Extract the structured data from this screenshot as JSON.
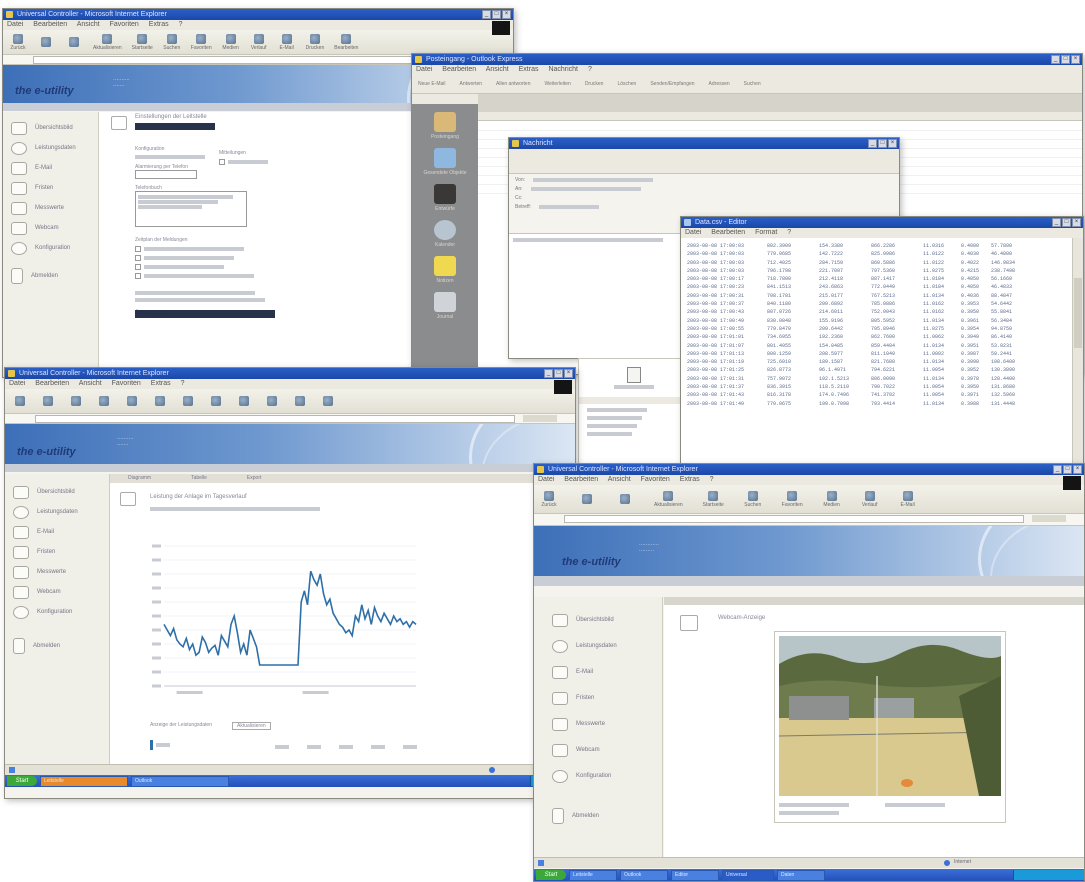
{
  "windows": {
    "topleft": {
      "title": "Universal Controller - Microsoft Internet Explorer",
      "menu": [
        "Datei",
        "Bearbeiten",
        "Ansicht",
        "Favoriten",
        "Extras",
        "?"
      ],
      "toolbar": [
        "Zurück",
        "",
        "",
        "Aktualisieren",
        "Startseite",
        "Suchen",
        "Favoriten",
        "Medien",
        "Verlauf",
        "E-Mail",
        "Drucken",
        "Bearbeiten"
      ],
      "brand": "the e-utility",
      "sidebar": [
        "Übersichtsbild",
        "Leistungsdaten",
        "E-Mail",
        "Fristen",
        "Messwerte",
        "Webcam",
        "Konfiguration",
        "Abmelden"
      ],
      "form": {
        "heading": "Einstellungen der Leitstelle",
        "section1": "Konfiguration",
        "section2": "Mitteilungen",
        "section3": "Alarmierung per Telefon",
        "section4": "Telefonbuch",
        "section5": "Zeitplan der Meldungen",
        "button": "Übernehmen"
      }
    },
    "email": {
      "title": "Posteingang - Outlook Express",
      "menu": [
        "Datei",
        "Bearbeiten",
        "Ansicht",
        "Extras",
        "Nachricht",
        "?"
      ],
      "toolbar": [
        "Neue E-Mail",
        "Antworten",
        "Allen antworten",
        "Weiterleiten",
        "Drucken",
        "Löschen",
        "Senden/Empfangen",
        "Adressen",
        "Suchen"
      ],
      "folders": [
        "Outlook Express",
        "Posteingang",
        "Gesendete Objekte",
        "Entwürfe",
        "Kalender",
        "Notizen",
        "Journal"
      ],
      "compose": {
        "title": "Nachricht",
        "from_label": "Von:",
        "to_label": "An:",
        "cc_label": "Cc:",
        "subject_label": "Betreff:"
      },
      "contacts": [
        "Anlage",
        "Kontakte"
      ]
    },
    "datalog": {
      "title": "Data.csv - Editor",
      "menu": [
        "Datei",
        "Bearbeiten",
        "Format",
        "?"
      ],
      "rows": [
        [
          "2003-08-08 17:00:03",
          "802.3909",
          "154.3380",
          "866.2286",
          "11.0316",
          "0.4000",
          "57.7800"
        ],
        [
          "2003-08-08 17:00:03",
          "779.0685",
          "142.7222",
          "825.0986",
          "11.0122",
          "0.4030",
          "46.4800"
        ],
        [
          "2003-08-08 17:00:03",
          "712.4025",
          "284.7159",
          "860.5886",
          "11.0122",
          "0.4022",
          "146.9834"
        ],
        [
          "2003-08-08 17:00:03",
          "796.1798",
          "221.7097",
          "797.5360",
          "11.0275",
          "0.4215",
          "238.7498"
        ],
        [
          "2003-08-08 17:00:17",
          "718.7800",
          "212.4118",
          "887.1417",
          "11.0184",
          "0.4050",
          "56.1660"
        ],
        [
          "2003-08-08 17:00:23",
          "841.1513",
          "243.6863",
          "772.0449",
          "11.0184",
          "0.4050",
          "46.4833"
        ],
        [
          "2003-08-08 17:00:31",
          "708.1781",
          "215.0177",
          "767.5213",
          "11.0134",
          "0.4036",
          "88.4847"
        ],
        [
          "2003-08-08 17:00:37",
          "840.1180",
          "209.6892",
          "785.0886",
          "11.0162",
          "0.3953",
          "54.6442"
        ],
        [
          "2003-08-08 17:00:43",
          "807.0726",
          "214.6011",
          "752.0043",
          "11.0162",
          "0.3950",
          "55.8841"
        ],
        [
          "2003-08-08 17:00:49",
          "830.0848",
          "155.9196",
          "805.5952",
          "11.0134",
          "0.3961",
          "56.3484"
        ],
        [
          "2003-08-08 17:00:55",
          "779.8470",
          "209.6442",
          "795.8946",
          "11.0275",
          "0.3954",
          "94.8750"
        ],
        [
          "2003-08-08 17:01:01",
          "734.6955",
          "192.2360",
          "862.7600",
          "11.0062",
          "0.3949",
          "86.4140"
        ],
        [
          "2003-08-08 17:01:07",
          "801.4955",
          "154.0485",
          "859.4404",
          "11.0134",
          "0.3951",
          "53.0231"
        ],
        [
          "2003-08-08 17:01:13",
          "800.1259",
          "208.5977",
          "811.1049",
          "11.0002",
          "0.3987",
          "59.2441"
        ],
        [
          "2003-08-08 17:01:19",
          "725.6010",
          "189.1587",
          "821.7680",
          "11.0134",
          "0.3998",
          "108.6400"
        ],
        [
          "2003-08-08 17:01:25",
          "826.8773",
          "96.1.4071",
          "794.6221",
          "11.0054",
          "0.3952",
          "130.3890"
        ],
        [
          "2003-08-08 17:01:31",
          "757.9072",
          "192.1.5213",
          "806.0090",
          "11.0134",
          "0.3978",
          "128.4400"
        ],
        [
          "2003-08-08 17:01:37",
          "836.3915",
          "118.5.2110",
          "790.7022",
          "11.0054",
          "0.3950",
          "131.8680"
        ],
        [
          "2003-08-08 17:01:43",
          "816.3178",
          "174.0.7496",
          "741.3702",
          "11.0054",
          "0.3971",
          "132.5960"
        ],
        [
          "2003-08-08 17:01:49",
          "770.0675",
          "199.0.7098",
          "793.4414",
          "11.0134",
          "0.3988",
          "131.4448"
        ]
      ]
    },
    "chart": {
      "title": "Universal Controller - Microsoft Internet Explorer",
      "menu": [
        "Datei",
        "Bearbeiten",
        "Ansicht",
        "Favoriten",
        "Extras",
        "?"
      ],
      "brand": "the e-utility",
      "sidebar": [
        "Übersichtsbild",
        "Leistungsdaten",
        "E-Mail",
        "Fristen",
        "Messwerte",
        "Webcam",
        "Konfiguration",
        "Abmelden"
      ],
      "tabs": [
        "Diagramm",
        "Tabelle",
        "Export"
      ],
      "heading": "Leistung der Anlage im Tagesverlauf",
      "legend_label": "Anzeige der Leistungsdaten",
      "legend_button": "Aktualisieren"
    },
    "webcam": {
      "title": "Universal Controller - Microsoft Internet Explorer",
      "menu": [
        "Datei",
        "Bearbeiten",
        "Ansicht",
        "Favoriten",
        "Extras",
        "?"
      ],
      "toolbar": [
        "Zurück",
        "",
        "",
        "Aktualisieren",
        "Startseite",
        "Suchen",
        "Favoriten",
        "Medien",
        "Verlauf",
        "E-Mail",
        "Drucken",
        "Bearbeiten"
      ],
      "brand": "the e-utility",
      "sidebar": [
        "Übersichtsbild",
        "Leistungsdaten",
        "E-Mail",
        "Fristen",
        "Messwerte",
        "Webcam",
        "Konfiguration",
        "Abmelden"
      ],
      "heading": "Webcam-Anzeige",
      "status": "Internet",
      "taskbar": [
        "Start",
        "Leitstelle",
        "Outlook",
        "Editor",
        "Universal",
        "Daten"
      ]
    }
  },
  "chart_data": {
    "type": "line",
    "series": [
      {
        "values": [
          44,
          40,
          36,
          41,
          33,
          30,
          28,
          34,
          26,
          30,
          22,
          24,
          35,
          31,
          24,
          27,
          29,
          22,
          36,
          32,
          28,
          44,
          50,
          38,
          24,
          30,
          22,
          40,
          34,
          28,
          15,
          15,
          15,
          15,
          15,
          15,
          15,
          15,
          15,
          15,
          15,
          15,
          15,
          60,
          68,
          58,
          82,
          76,
          72,
          80,
          66,
          58,
          62,
          52,
          48,
          44,
          42,
          38,
          40,
          36,
          50,
          46,
          58,
          48,
          54,
          44,
          56,
          50,
          46,
          52,
          48,
          44,
          50,
          46,
          48,
          44,
          46,
          42,
          46,
          44
        ]
      }
    ],
    "ylim": [
      0,
      100
    ],
    "grid": true
  },
  "colors": {
    "series": "#2f6fa8",
    "titlebar": "#1b48a8",
    "banner": "#3d6fb8"
  }
}
